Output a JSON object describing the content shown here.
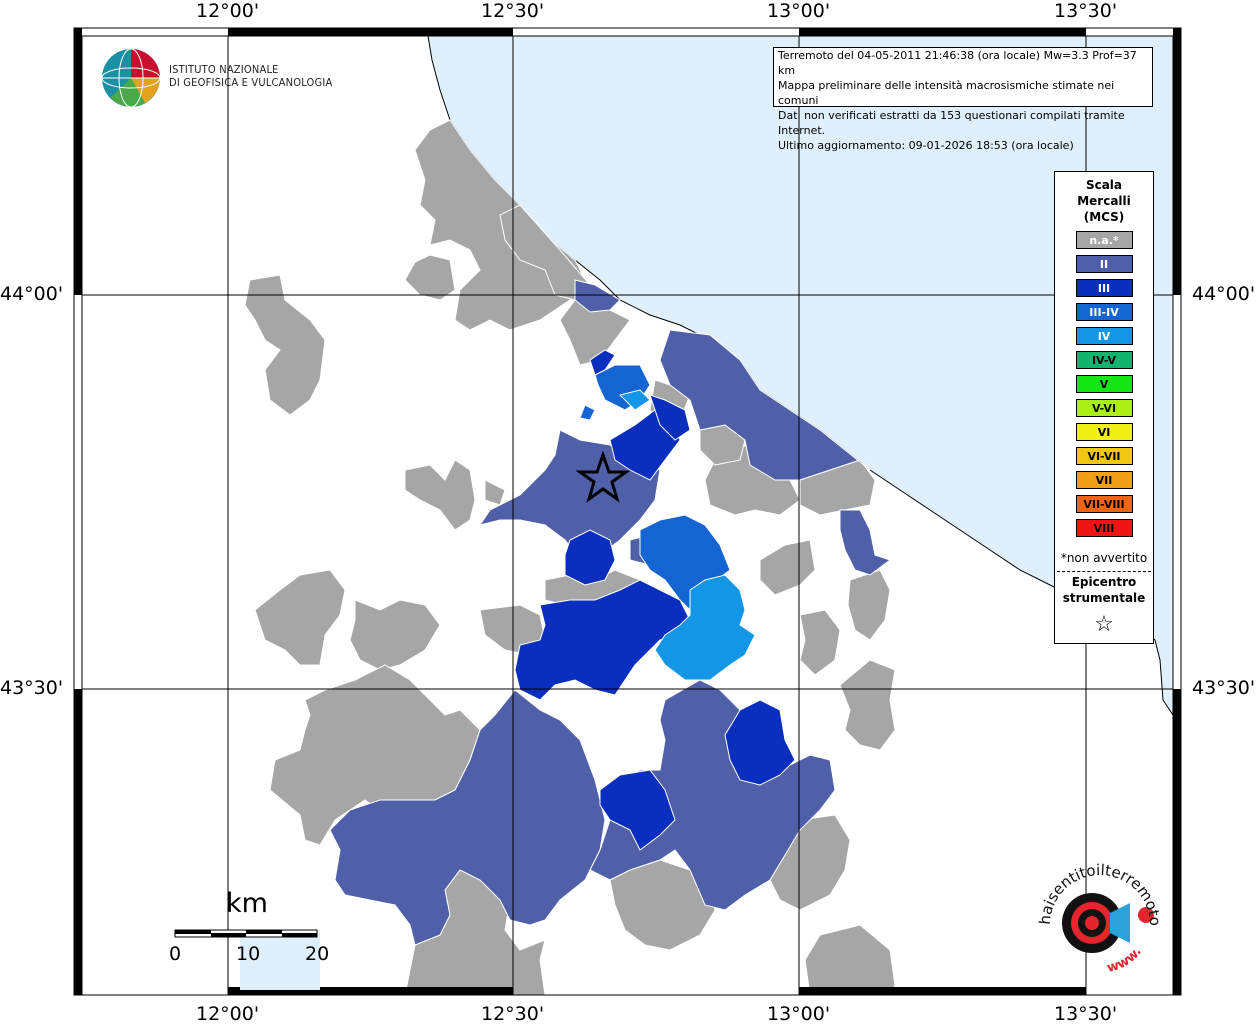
{
  "map": {
    "lon_ticks": [
      "12°00'",
      "12°30'",
      "13°00'",
      "13°30'"
    ],
    "lat_ticks": [
      "44°00'",
      "43°30'"
    ]
  },
  "info": {
    "line1": "Terremoto del 04-05-2011 21:46:38 (ora locale) Mw=3.3 Prof=37 km",
    "line2": "Mappa preliminare delle intensità macrosismiche stimate nei comuni",
    "line3": "Dati non verificati estratti da 153 questionari compilati tramite Internet.",
    "line4": "Ultimo aggiornamento: 09-01-2026 18:53 (ora locale)"
  },
  "logo": {
    "line1": "ISTITUTO NAZIONALE",
    "line2": "DI GEOFISICA E VULCANOLOGIA"
  },
  "legend": {
    "title1": "Scala",
    "title2": "Mercalli",
    "title3": "(MCS)",
    "items": [
      {
        "label": "n.a.*",
        "color": "#a6a6a6",
        "text_color": "#ffffff"
      },
      {
        "label": "II",
        "color": "#5060a8",
        "text_color": "#ffffff"
      },
      {
        "label": "III",
        "color": "#0a2ebd",
        "text_color": "#ffffff"
      },
      {
        "label": "III-IV",
        "color": "#1464d2",
        "text_color": "#ffffff"
      },
      {
        "label": "IV",
        "color": "#1496e6",
        "text_color": "#ffffff"
      },
      {
        "label": "IV-V",
        "color": "#10b46e",
        "text_color": "#000000"
      },
      {
        "label": "V",
        "color": "#14e614",
        "text_color": "#000000"
      },
      {
        "label": "V-VI",
        "color": "#aaf014",
        "text_color": "#000000"
      },
      {
        "label": "VI",
        "color": "#f0f014",
        "text_color": "#000000"
      },
      {
        "label": "VI-VII",
        "color": "#f0c814",
        "text_color": "#000000"
      },
      {
        "label": "VII",
        "color": "#f0a014",
        "text_color": "#000000"
      },
      {
        "label": "VII-VIII",
        "color": "#f06414",
        "text_color": "#000000"
      },
      {
        "label": "VIII",
        "color": "#f01414",
        "text_color": "#000000"
      }
    ],
    "non_avvertito": "*non avvertito",
    "epicentro1": "Epicentro",
    "epicentro2": "strumentale",
    "star": "☆"
  },
  "scale_bar": {
    "unit": "km",
    "labels": [
      "0",
      "10",
      "20"
    ]
  },
  "brand": {
    "text": "haisentitoilterremoto.it",
    "www": "www."
  },
  "colors": {
    "sea": "#dff0fc",
    "na": "#a6a6a6",
    "ii": "#5060a8",
    "iii": "#0a2ebd",
    "iii_iv": "#1464d2",
    "iv": "#1496e6"
  }
}
